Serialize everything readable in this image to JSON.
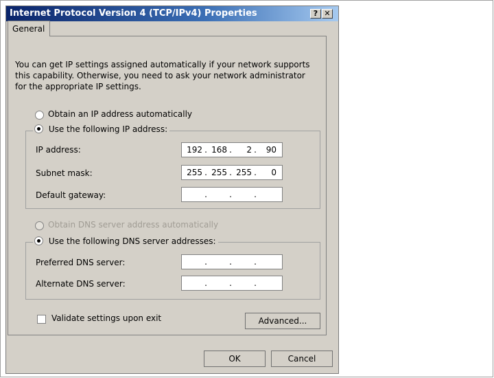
{
  "dialog": {
    "title": "Internet Protocol Version 4 (TCP/IPv4) Properties",
    "help_label": "?",
    "close_label": "✕"
  },
  "tabs": [
    {
      "label": "General"
    }
  ],
  "intro_text": "You can get IP settings assigned automatically if your network supports this capability. Otherwise, you need to ask your network administrator for the appropriate IP settings.",
  "ip_section": {
    "auto_label": "Obtain an IP address automatically",
    "manual_label": "Use the following IP address:",
    "selected": "manual",
    "fields": [
      {
        "label": "IP address:",
        "octets": [
          "192",
          "168",
          "2",
          "90"
        ]
      },
      {
        "label": "Subnet mask:",
        "octets": [
          "255",
          "255",
          "255",
          "0"
        ]
      },
      {
        "label": "Default gateway:",
        "octets": [
          "",
          "",
          "",
          ""
        ]
      }
    ]
  },
  "dns_section": {
    "auto_label": "Obtain DNS server address automatically",
    "auto_disabled": true,
    "manual_label": "Use the following DNS server addresses:",
    "selected": "manual",
    "fields": [
      {
        "label": "Preferred DNS server:",
        "octets": [
          "",
          "",
          "",
          ""
        ]
      },
      {
        "label": "Alternate DNS server:",
        "octets": [
          "",
          "",
          "",
          ""
        ]
      }
    ]
  },
  "validate": {
    "label": "Validate settings upon exit",
    "checked": false
  },
  "buttons": {
    "advanced": "Advanced...",
    "ok": "OK",
    "cancel": "Cancel"
  },
  "icons": {
    "help": "help-icon",
    "close": "close-icon"
  }
}
